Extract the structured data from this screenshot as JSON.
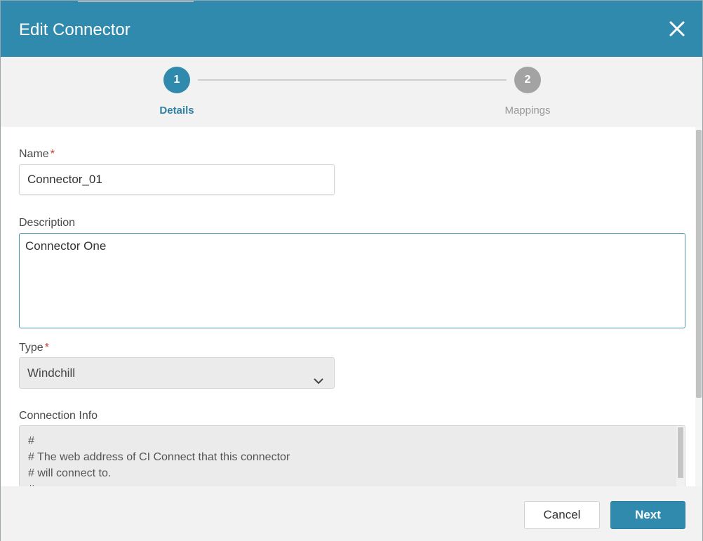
{
  "header": {
    "title": "Edit Connector",
    "close_icon": "close-icon"
  },
  "stepper": {
    "steps": [
      {
        "number": "1",
        "label": "Details",
        "state": "active"
      },
      {
        "number": "2",
        "label": "Mappings",
        "state": "inactive"
      }
    ]
  },
  "form": {
    "name": {
      "label": "Name",
      "required_mark": "*",
      "value": "Connector_01"
    },
    "description": {
      "label": "Description",
      "value": "Connector One"
    },
    "type": {
      "label": "Type",
      "required_mark": "*",
      "selected": "Windchill",
      "icon": "chevron-down-icon"
    },
    "connection_info": {
      "label": "Connection Info",
      "lines": [
        "#",
        "# The web address of CI Connect that this connector",
        "# will connect to.",
        "#"
      ]
    }
  },
  "footer": {
    "cancel_label": "Cancel",
    "next_label": "Next"
  },
  "colors": {
    "accent": "#2f8aad",
    "required": "#d0342c",
    "inactive_step": "#a3a3a3"
  }
}
